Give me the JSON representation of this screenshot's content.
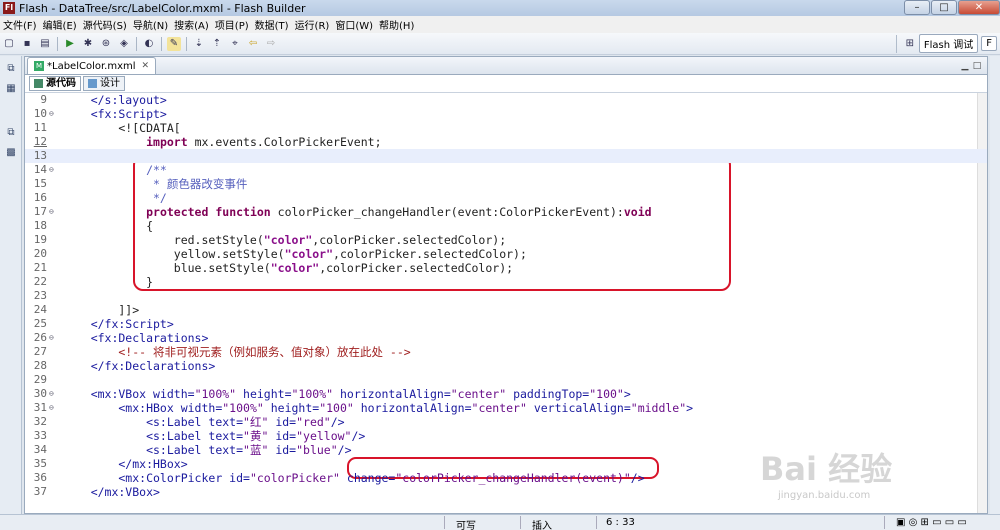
{
  "window": {
    "title": "Flash - DataTree/src/LabelColor.mxml - Flash Builder",
    "app_icon": "Fl",
    "min": "–",
    "max": "□",
    "close": "✕"
  },
  "menu": [
    "文件(F)",
    "编辑(E)",
    "源代码(S)",
    "导航(N)",
    "搜索(A)",
    "项目(P)",
    "数据(T)",
    "运行(R)",
    "窗口(W)",
    "帮助(H)"
  ],
  "toolbar": {
    "perspective_label": "Flash 调试",
    "perspective_label2": "F"
  },
  "editor": {
    "tab_label": "*LabelColor.mxml",
    "mode_source": "源代码",
    "mode_design": "设计"
  },
  "code_lines": [
    {
      "n": "9",
      "fold": "",
      "parts": [
        [
          "tag",
          "    </s:layout>"
        ]
      ]
    },
    {
      "n": "10",
      "fold": "⊖",
      "parts": [
        [
          "tag",
          "    <fx:Script>"
        ]
      ]
    },
    {
      "n": "11",
      "fold": "",
      "parts": [
        [
          "plain",
          "        <![CDATA["
        ]
      ]
    },
    {
      "n": "12",
      "fold": "",
      "parts": [
        [
          "plain",
          "            "
        ],
        [
          "kw",
          "import"
        ],
        [
          "plain",
          " mx.events.ColorPickerEvent;"
        ]
      ]
    },
    {
      "n": "13",
      "fold": "",
      "parts": [
        [
          "plain",
          ""
        ]
      ]
    },
    {
      "n": "14",
      "fold": "⊖",
      "parts": [
        [
          "comment",
          "            /**"
        ]
      ]
    },
    {
      "n": "15",
      "fold": "",
      "parts": [
        [
          "comment",
          "             * 颜色器改变事件"
        ]
      ]
    },
    {
      "n": "16",
      "fold": "",
      "parts": [
        [
          "comment",
          "             */"
        ]
      ]
    },
    {
      "n": "17",
      "fold": "⊖",
      "parts": [
        [
          "plain",
          "            "
        ],
        [
          "kw",
          "protected"
        ],
        [
          "plain",
          " "
        ],
        [
          "kw",
          "function"
        ],
        [
          "plain",
          " colorPicker_changeHandler(event:ColorPickerEvent):"
        ],
        [
          "kw",
          "void"
        ]
      ]
    },
    {
      "n": "18",
      "fold": "",
      "parts": [
        [
          "plain",
          "            {"
        ]
      ]
    },
    {
      "n": "19",
      "fold": "",
      "parts": [
        [
          "plain",
          "                red.setStyle("
        ],
        [
          "strbold",
          "\"color\""
        ],
        [
          "plain",
          ",colorPicker.selectedColor);"
        ]
      ]
    },
    {
      "n": "20",
      "fold": "",
      "parts": [
        [
          "plain",
          "                yellow.setStyle("
        ],
        [
          "strbold",
          "\"color\""
        ],
        [
          "plain",
          ",colorPicker.selectedColor);"
        ]
      ]
    },
    {
      "n": "21",
      "fold": "",
      "parts": [
        [
          "plain",
          "                blue.setStyle("
        ],
        [
          "strbold",
          "\"color\""
        ],
        [
          "plain",
          ",colorPicker.selectedColor);"
        ]
      ]
    },
    {
      "n": "22",
      "fold": "",
      "parts": [
        [
          "plain",
          "            }"
        ]
      ]
    },
    {
      "n": "23",
      "fold": "",
      "parts": [
        [
          "plain",
          ""
        ]
      ]
    },
    {
      "n": "24",
      "fold": "",
      "parts": [
        [
          "plain",
          "        ]]>"
        ]
      ]
    },
    {
      "n": "25",
      "fold": "",
      "parts": [
        [
          "tag",
          "    </fx:Script>"
        ]
      ]
    },
    {
      "n": "26",
      "fold": "⊖",
      "parts": [
        [
          "tag",
          "    <fx:Declarations>"
        ]
      ]
    },
    {
      "n": "27",
      "fold": "",
      "parts": [
        [
          "xmlcomment",
          "        <!-- 将非可视元素（例如服务、值对象）放在此处 -->"
        ]
      ]
    },
    {
      "n": "28",
      "fold": "",
      "parts": [
        [
          "tag",
          "    </fx:Declarations>"
        ]
      ]
    },
    {
      "n": "29",
      "fold": "",
      "parts": [
        [
          "plain",
          ""
        ]
      ]
    },
    {
      "n": "30",
      "fold": "⊖",
      "parts": [
        [
          "tag",
          "    <mx:VBox "
        ],
        [
          "attr",
          "width="
        ],
        [
          "str",
          "\"100%\""
        ],
        [
          "attr",
          " height="
        ],
        [
          "str",
          "\"100%\""
        ],
        [
          "attr",
          " horizontalAlign="
        ],
        [
          "str",
          "\"center\""
        ],
        [
          "attr",
          " paddingTop="
        ],
        [
          "str",
          "\"100\""
        ],
        [
          "tag",
          ">"
        ]
      ]
    },
    {
      "n": "31",
      "fold": "⊖",
      "parts": [
        [
          "tag",
          "        <mx:HBox "
        ],
        [
          "attr",
          "width="
        ],
        [
          "str",
          "\"100%\""
        ],
        [
          "attr",
          " height="
        ],
        [
          "str",
          "\"100\""
        ],
        [
          "attr",
          " horizontalAlign="
        ],
        [
          "str",
          "\"center\""
        ],
        [
          "attr",
          " verticalAlign="
        ],
        [
          "str",
          "\"middle\""
        ],
        [
          "tag",
          ">"
        ]
      ]
    },
    {
      "n": "32",
      "fold": "",
      "parts": [
        [
          "tag",
          "            <s:Label "
        ],
        [
          "attr",
          "text="
        ],
        [
          "str",
          "\"红\""
        ],
        [
          "attr",
          " id="
        ],
        [
          "str",
          "\"red\""
        ],
        [
          "tag",
          "/>"
        ]
      ]
    },
    {
      "n": "33",
      "fold": "",
      "parts": [
        [
          "tag",
          "            <s:Label "
        ],
        [
          "attr",
          "text="
        ],
        [
          "str",
          "\"黄\""
        ],
        [
          "attr",
          " id="
        ],
        [
          "str",
          "\"yellow\""
        ],
        [
          "tag",
          "/>"
        ]
      ]
    },
    {
      "n": "34",
      "fold": "",
      "parts": [
        [
          "tag",
          "            <s:Label "
        ],
        [
          "attr",
          "text="
        ],
        [
          "str",
          "\"蓝\""
        ],
        [
          "attr",
          " id="
        ],
        [
          "str",
          "\"blue\""
        ],
        [
          "tag",
          "/>"
        ]
      ]
    },
    {
      "n": "35",
      "fold": "",
      "parts": [
        [
          "tag",
          "        </mx:HBox>"
        ]
      ]
    },
    {
      "n": "36",
      "fold": "",
      "parts": [
        [
          "tag",
          "        <mx:ColorPicker "
        ],
        [
          "attr",
          "id="
        ],
        [
          "str",
          "\"colorPicker\""
        ],
        [
          "attr",
          " change="
        ],
        [
          "str",
          "\"colorPicker_changeHandler(event)\""
        ],
        [
          "tag",
          "/>"
        ]
      ]
    },
    {
      "n": "37",
      "fold": "",
      "parts": [
        [
          "tag",
          "    </mx:VBox>"
        ]
      ]
    }
  ],
  "status": {
    "writable": "可写",
    "insert": "插入",
    "position": "6 : 33"
  },
  "watermark": {
    "logo": "Bai 经验",
    "url": "jingyan.baidu.com"
  },
  "colors": {
    "highlight_box": "#d8142a"
  }
}
